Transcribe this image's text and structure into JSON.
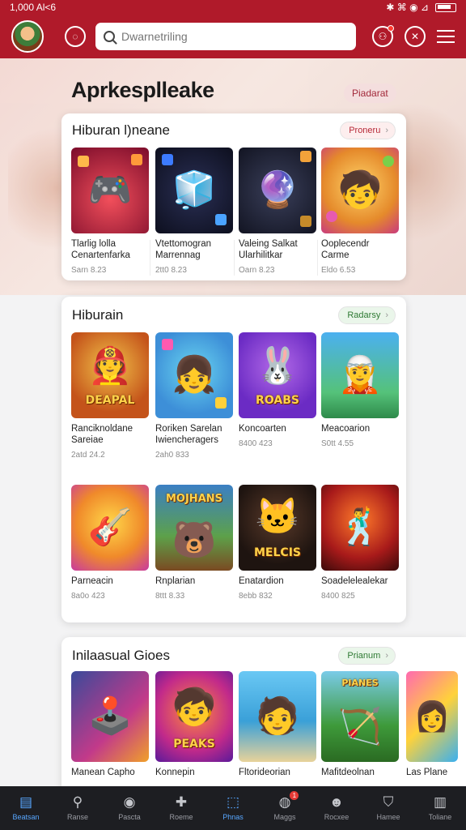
{
  "status_bar": {
    "time": "1,000 Al&lt;6",
    "signal": "✱ ⌘ ◉ ⊿"
  },
  "header": {
    "search_placeholder": "Dwarnetriling"
  },
  "page": {
    "title": "Aprkesplleake",
    "title_button": "Piadarat"
  },
  "sections": [
    {
      "title": "Hiburan l)neane",
      "pill": "Proneru",
      "tiles": [
        {
          "name": "Tlarlig lolla Cenartenfarka",
          "meta": "Sarn 8.23",
          "icon": "controller-mascot-icon"
        },
        {
          "name": "Vtettomogran Marrennag",
          "meta": "2tt0 8.23",
          "icon": "neon-cube-icon"
        },
        {
          "name": "Valeing Salkat Ularhilitkar",
          "meta": "Oarn 8.23",
          "icon": "space-orb-icon"
        },
        {
          "name": "Ooplecendr Carme",
          "meta": "Eldo 6.53",
          "icon": "jungle-hero-icon"
        }
      ]
    },
    {
      "title": "Hiburain",
      "pill": "Radarsy",
      "tiles": [
        {
          "name": "Ranciknoldane Sareiae",
          "meta": "2atd 24.2",
          "icon": "adventure-boy-icon",
          "banner": "DEAPAL"
        },
        {
          "name": "Roriken Sarelan Iwiencheragers",
          "meta": "2ah0 833",
          "icon": "puzzle-girl-icon"
        },
        {
          "name": "Koncoarten",
          "meta": "8400 423",
          "icon": "yellow-bunny-icon",
          "banner": "ROABS"
        },
        {
          "name": "Meacoarion",
          "meta": "S0tt 4.55",
          "icon": "island-girl-icon"
        },
        {
          "name": "Parneacin",
          "meta": "8a0o 423",
          "icon": "guitar-boy-icon"
        },
        {
          "name": "Rnplarian",
          "meta": "8ttt 8.33",
          "icon": "safari-bear-icon",
          "banner": "MOJHANS"
        },
        {
          "name": "Enatardion",
          "meta": "8ebb 832",
          "icon": "cat-warrior-icon",
          "banner": "MELCIS"
        },
        {
          "name": "Soadelelealekar",
          "meta": "8400 825",
          "icon": "action-hero-icon"
        }
      ]
    },
    {
      "title": "Inilaasual Gioes",
      "pill": "Prianum",
      "tiles": [
        {
          "name": "Manean Capho",
          "icon": "arcade-player-icon"
        },
        {
          "name": "Konnepin",
          "icon": "candy-blast-icon",
          "banner": "PEAKS"
        },
        {
          "name": "Fltorideorian",
          "icon": "beach-boy-icon"
        },
        {
          "name": "Mafitdeolnan",
          "icon": "jungle-hunter-icon",
          "banner": "PIANES"
        },
        {
          "name": "Las Plane",
          "icon": "rainbow-girl-icon"
        }
      ]
    }
  ],
  "bottom_nav": [
    {
      "label": "Beatsan",
      "icon": "home-icon"
    },
    {
      "label": "Ranse",
      "icon": "search-icon"
    },
    {
      "label": "Pascta",
      "icon": "game-icon"
    },
    {
      "label": "Roeme",
      "icon": "controller-icon"
    },
    {
      "label": "Phnas",
      "icon": "box-icon"
    },
    {
      "label": "Maggs",
      "icon": "chat-icon",
      "badge": "1"
    },
    {
      "label": "Rocxee",
      "icon": "profile-icon"
    },
    {
      "label": "Hamee",
      "icon": "shield-icon"
    },
    {
      "label": "Toliane",
      "icon": "store-icon"
    }
  ],
  "colors": {
    "brand_red": "#b01a2a",
    "nav_dark": "#1d1e22",
    "active_blue": "#58a7ff"
  }
}
